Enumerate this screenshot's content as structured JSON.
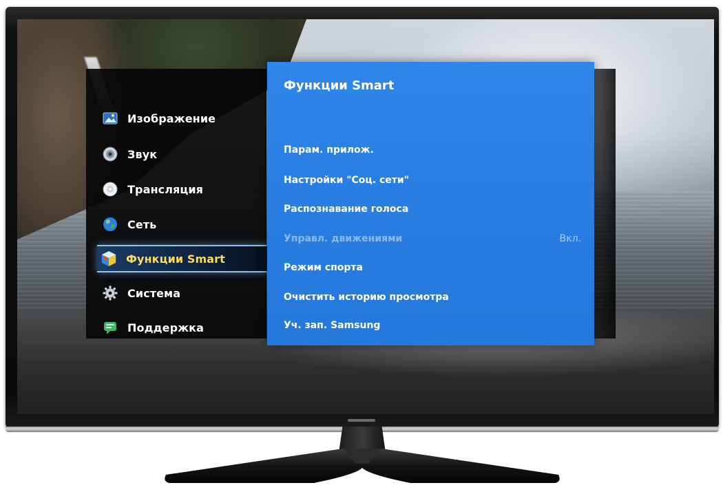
{
  "menu": {
    "items": [
      {
        "label": "Изображение",
        "icon": "picture-icon"
      },
      {
        "label": "Звук",
        "icon": "speaker-icon"
      },
      {
        "label": "Трансляция",
        "icon": "broadcast-icon"
      },
      {
        "label": "Сеть",
        "icon": "globe-icon"
      },
      {
        "label": "Функции Smart",
        "icon": "smart-box-icon",
        "selected": true
      },
      {
        "label": "Система",
        "icon": "gear-icon"
      },
      {
        "label": "Поддержка",
        "icon": "support-icon"
      }
    ]
  },
  "panel": {
    "title": "Функции Smart",
    "items": [
      {
        "label": "Парам. прилож.",
        "value": ""
      },
      {
        "label": "Настройки \"Соц. сети\"",
        "value": ""
      },
      {
        "label": "Распознавание голоса",
        "value": ""
      },
      {
        "label": "Управл. движениями",
        "value": "Вкл.",
        "disabled": true
      },
      {
        "label": "Режим спорта",
        "value": ""
      },
      {
        "label": "Очистить историю просмотра",
        "value": ""
      },
      {
        "label": "Уч. зап. Samsung",
        "value": ""
      }
    ]
  },
  "colors": {
    "panel_blue": "#2a7fe3",
    "menu_black": "#060606",
    "selected_text": "#ffd95a",
    "selection_glow": "#a4d4ff"
  }
}
